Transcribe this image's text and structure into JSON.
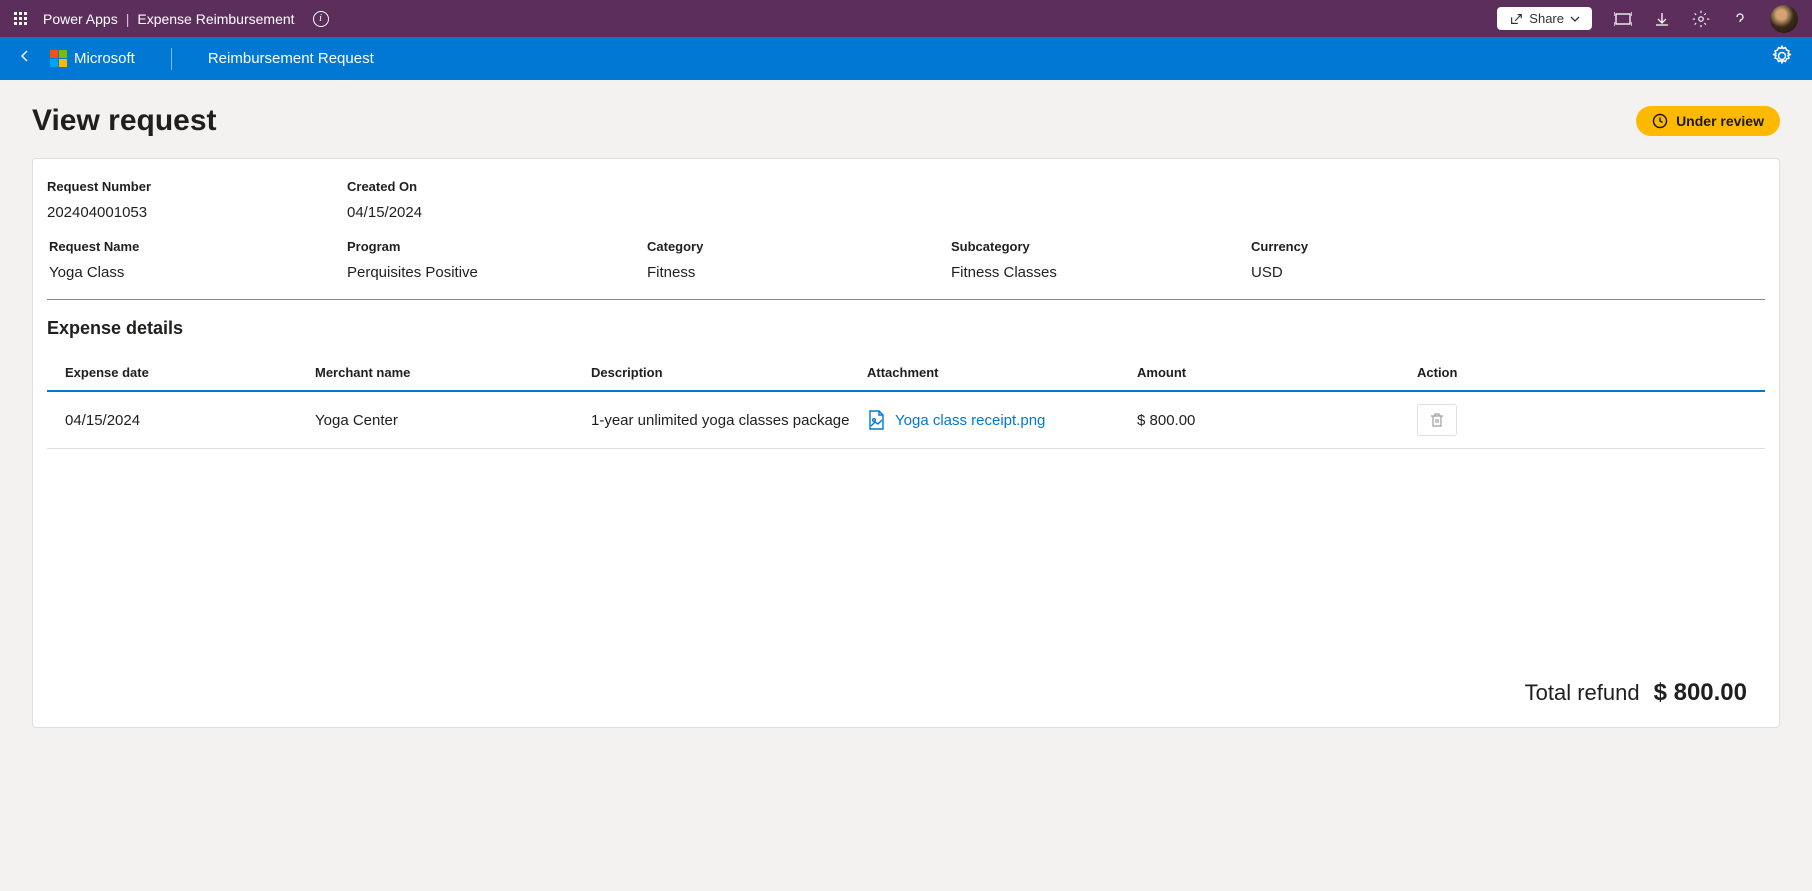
{
  "topBar": {
    "appName": "Power Apps",
    "appSubtitle": "Expense Reimbursement",
    "shareLabel": "Share"
  },
  "appBar": {
    "brand": "Microsoft",
    "pageTitle": "Reimbursement Request"
  },
  "page": {
    "title": "View request",
    "statusLabel": "Under review"
  },
  "fields": {
    "requestNumber": {
      "label": "Request Number",
      "value": "202404001053"
    },
    "createdOn": {
      "label": "Created On",
      "value": "04/15/2024"
    },
    "requestName": {
      "label": "Request Name",
      "value": "Yoga Class"
    },
    "program": {
      "label": "Program",
      "value": "Perquisites Positive"
    },
    "category": {
      "label": "Category",
      "value": "Fitness"
    },
    "subcategory": {
      "label": "Subcategory",
      "value": "Fitness Classes"
    },
    "currency": {
      "label": "Currency",
      "value": "USD"
    }
  },
  "expense": {
    "sectionTitle": "Expense details",
    "headers": {
      "date": "Expense date",
      "merchant": "Merchant name",
      "description": "Description",
      "attachment": "Attachment",
      "amount": "Amount",
      "action": "Action"
    },
    "rows": [
      {
        "date": "04/15/2024",
        "merchant": "Yoga Center",
        "description": "1-year unlimited yoga classes package",
        "attachment": "Yoga class receipt.png",
        "amount": "$ 800.00"
      }
    ]
  },
  "total": {
    "label": "Total refund",
    "value": "$ 800.00"
  }
}
